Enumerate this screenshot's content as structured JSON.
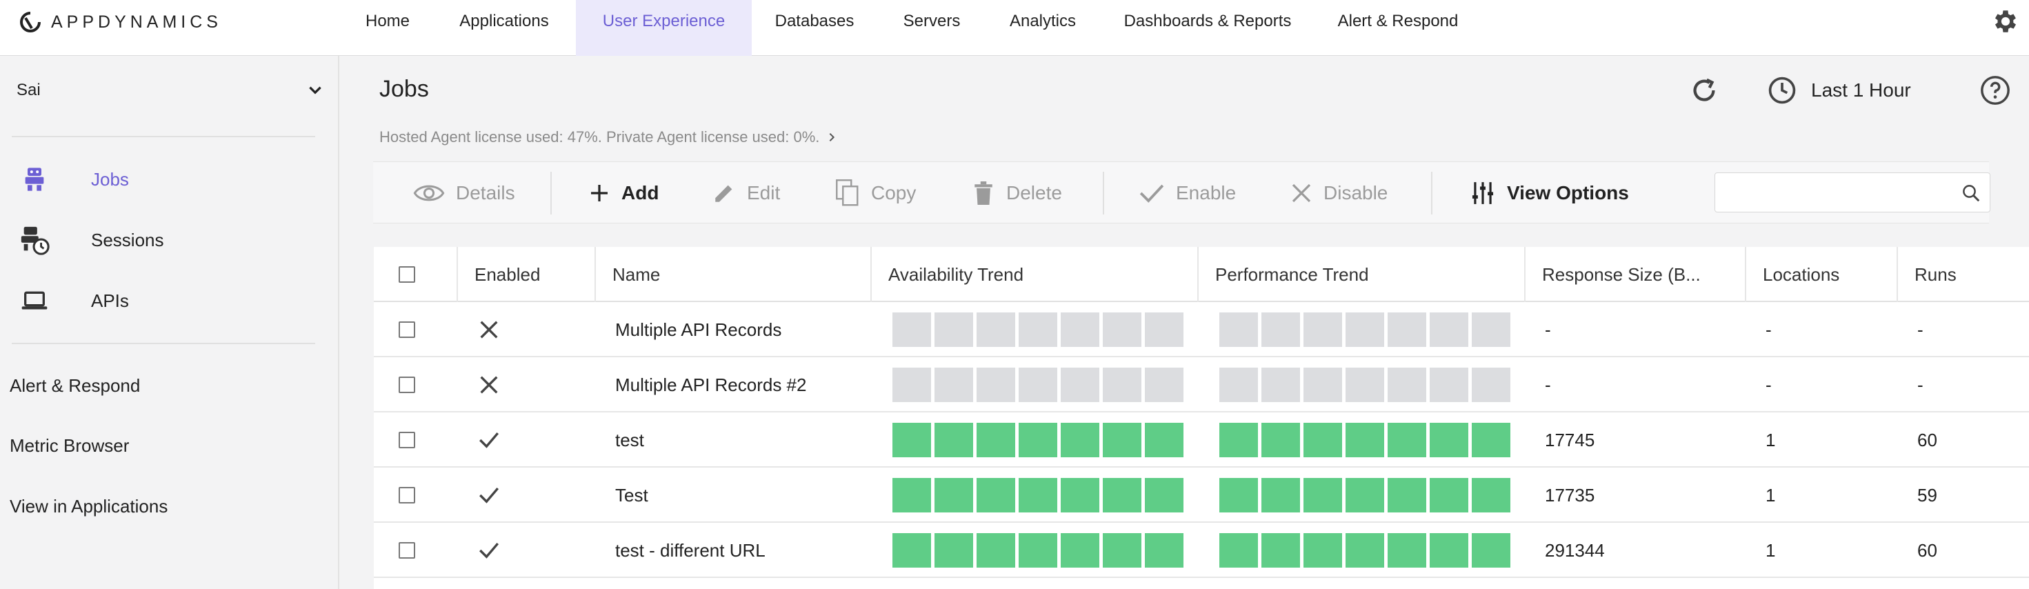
{
  "header": {
    "logo_text": "APPDYNAMICS",
    "nav": [
      "Home",
      "Applications",
      "User Experience",
      "Databases",
      "Servers",
      "Analytics",
      "Dashboards & Reports",
      "Alert & Respond"
    ],
    "active_nav": "User Experience",
    "accent_color": "#6c5fd4"
  },
  "sidebar": {
    "tenant": "Sai",
    "items": [
      {
        "label": "Jobs",
        "icon": "robot-icon",
        "active": true
      },
      {
        "label": "Sessions",
        "icon": "robot-clock-icon",
        "active": false
      },
      {
        "label": "APIs",
        "icon": "laptop-icon",
        "active": false
      }
    ],
    "links": [
      "Alert & Respond",
      "Metric Browser",
      "View in Applications"
    ]
  },
  "page": {
    "title": "Jobs",
    "license_text": "Hosted Agent license used: 47%. Private Agent license used: 0%.",
    "time_range": "Last 1 Hour"
  },
  "toolbar": {
    "details": "Details",
    "add": "Add",
    "edit": "Edit",
    "copy": "Copy",
    "delete": "Delete",
    "enable": "Enable",
    "disable": "Disable",
    "view_options": "View Options",
    "search_value": ""
  },
  "table": {
    "columns": [
      "Enabled",
      "Name",
      "Availability Trend",
      "Performance Trend",
      "Response Size (B...",
      "Locations",
      "Runs"
    ],
    "rows": [
      {
        "enabled": false,
        "name": "Multiple API Records",
        "availability": "none",
        "performance": "none",
        "response_size": "-",
        "locations": "-",
        "runs": "-"
      },
      {
        "enabled": false,
        "name": "Multiple API Records #2",
        "availability": "none",
        "performance": "none",
        "response_size": "-",
        "locations": "-",
        "runs": "-"
      },
      {
        "enabled": true,
        "name": "test",
        "availability": "good",
        "performance": "good",
        "response_size": "17745",
        "locations": "1",
        "runs": "60"
      },
      {
        "enabled": true,
        "name": "Test",
        "availability": "good",
        "performance": "good",
        "response_size": "17735",
        "locations": "1",
        "runs": "59"
      },
      {
        "enabled": true,
        "name": "test - different URL",
        "availability": "good",
        "performance": "good",
        "response_size": "291344",
        "locations": "1",
        "runs": "60"
      }
    ],
    "trend_colors": {
      "good": "#5fcd87",
      "none": "#dcdde0"
    }
  }
}
